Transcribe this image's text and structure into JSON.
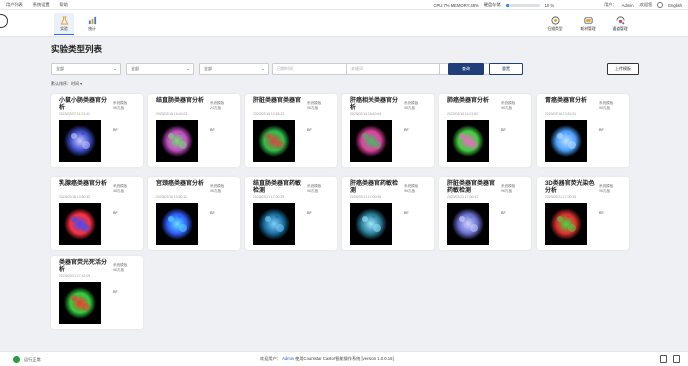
{
  "menubar": {
    "items": [
      "用户列表",
      "系统设置",
      "帮助"
    ],
    "cpu": "CPU:7% MEMORY:48%",
    "disk_label": "硬盘存储",
    "disk_percent": "10 %",
    "disk_fraction": 0.1,
    "user_label": "用户：",
    "user_name": "Admin",
    "welcome": ",欢迎您",
    "language": "English"
  },
  "toolbar": {
    "left": [
      {
        "label": "实验",
        "icon": "experiment-icon"
      },
      {
        "label": "统计",
        "icon": "statistics-icon"
      }
    ],
    "right": [
      {
        "label": "扫描类型",
        "icon": "scan-type-icon"
      },
      {
        "label": "耗材管理",
        "icon": "consumable-icon"
      },
      {
        "label": "通道管理",
        "icon": "channel-icon"
      }
    ]
  },
  "page": {
    "title": "实验类型列表",
    "filters": [
      {
        "value": "全部",
        "type": "select"
      },
      {
        "value": "全部",
        "type": "select"
      },
      {
        "value": "全部",
        "type": "select"
      }
    ],
    "search_time_placeholder": "日期时间",
    "search_keyword_placeholder": "关键词",
    "search_button": "查询",
    "reset_button": "重置",
    "upload_button": "上传模板",
    "sort_label": "默认排序：",
    "sort_value": "时间"
  },
  "cards": [
    {
      "name": "小鼠小肠类器官分析",
      "date": "2023/02/07 11:21:41",
      "meta1": "系统模板",
      "meta2": "96孔板",
      "bf": "BF",
      "palette": "#3b4ec9,#c9c9ff"
    },
    {
      "name": "结直肠类器官分析",
      "date": "2023/02/16 16:40:03",
      "meta1": "系统模板",
      "meta2": "24孔板",
      "bf": "BF",
      "palette": "#c44cc4,#6fe06f"
    },
    {
      "name": "肝脏类器官类器官",
      "date": "2023/02/16 10:25:23",
      "meta1": "系统模板",
      "meta2": "96孔板",
      "bf": "BF",
      "palette": "#2fc04a,#e04040"
    },
    {
      "name": "肝癌相关类器官分析",
      "date": "2023/02/16 16:40:54",
      "meta1": "系统模板",
      "meta2": "96孔板",
      "bf": "BF",
      "palette": "#e040a0,#40c060"
    },
    {
      "name": "肺癌类器官分析",
      "date": "2023/02/16 11:01:52",
      "meta1": "系统模板",
      "meta2": "96孔板",
      "bf": "BF",
      "palette": "#40d040,#ff60d0"
    },
    {
      "name": "胃癌类器官分析",
      "date": "2023/02/16 10:51:51",
      "meta1": "系统模板",
      "meta2": "96孔板",
      "bf": "BF",
      "palette": "#4aa0ff,#c0e0ff"
    },
    {
      "name": "乳腺癌类器官分析",
      "date": "2023/02/16 10:50:32",
      "meta1": "系统模板",
      "meta2": "48孔板",
      "bf": "BF",
      "palette": "#ff3040,#3050ff"
    },
    {
      "name": "宫颈癌类器官分析",
      "date": "2023/02/16 10:50:11",
      "meta1": "系统模板",
      "meta2": "96孔板",
      "bf": "BF",
      "palette": "#3060ff,#60e0ff"
    },
    {
      "name": "结直肠类器官药敏检测",
      "date": "2023/02/21 17:00:29",
      "meta1": "系统模板",
      "meta2": "96孔板",
      "bf": "BF",
      "palette": "#1b6fa0,#80d0ff"
    },
    {
      "name": "肝癌类器官药敏检测",
      "date": "2023/02/21 17:00:55",
      "meta1": "系统模板",
      "meta2": "96孔板",
      "bf": "BF",
      "palette": "#2a7f9a,#a0e8ff"
    },
    {
      "name": "肝脏类器官类器官药敏检测",
      "date": "2023/02/21 17:00:41",
      "meta1": "系统模板",
      "meta2": "96孔板",
      "bf": "BF",
      "palette": "#6a70d0,#d0d4ff"
    },
    {
      "name": "3D类器官荧光染色分析",
      "date": "2023/02/21 17:00:25",
      "meta1": "系统模板",
      "meta2": "96孔板",
      "bf": "BF",
      "palette": "#e03030,#40e040"
    },
    {
      "name": "类器官荧光死活分析",
      "date": "2023/02/21 17:42:09",
      "meta1": "系统模板",
      "meta2": "96孔板",
      "bf": "BF",
      "palette": "#30d040,#ff3030"
    }
  ],
  "statusbar": {
    "status": "运行正常",
    "welcome": "欢迎用户：",
    "user": "Admin",
    "system": "使用Countstar Castor智能操作系统 [version 1.0.0.15]"
  }
}
